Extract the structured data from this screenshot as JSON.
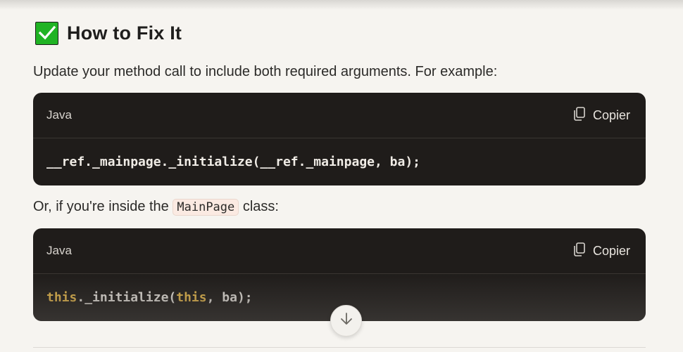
{
  "heading": {
    "icon": "check-mark-icon",
    "text": "How to Fix It"
  },
  "intro_text": "Update your method call to include both required arguments. For example:",
  "code_blocks": [
    {
      "language": "Java",
      "copy_label": "Copier",
      "code": "__ref._mainpage._initialize(__ref._mainpage, ba);"
    },
    {
      "language": "Java",
      "copy_label": "Copier",
      "code_parts": [
        "this",
        "._initialize(",
        "this",
        ", ba);"
      ]
    }
  ],
  "middle_text": {
    "before": "Or, if you're inside the",
    "inline_code": "MainPage",
    "after": "class:"
  },
  "colors": {
    "background": "#f6f4f0",
    "code_background": "#1f1c1a",
    "keyword": "#f2c14e",
    "check_green": "#20b324"
  }
}
